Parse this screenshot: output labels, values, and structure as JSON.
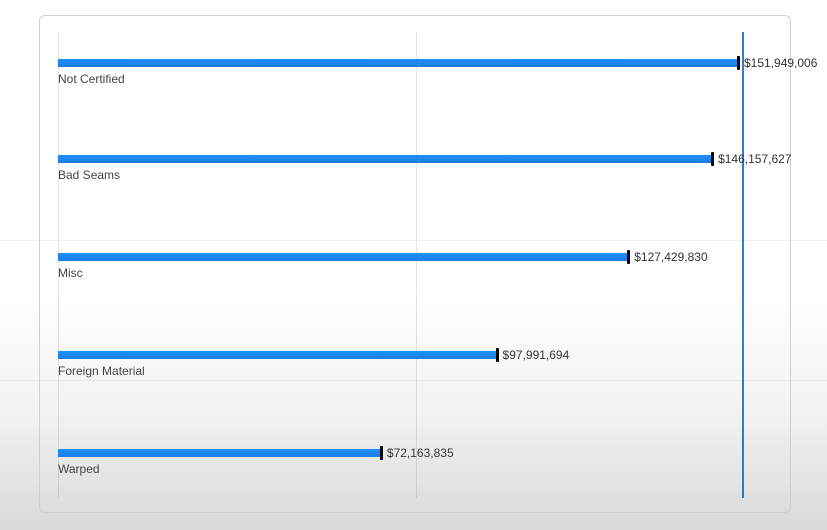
{
  "chart_data": {
    "type": "bar",
    "orientation": "horizontal",
    "categories": [
      "Not Certified",
      "Bad Seams",
      "Misc",
      "Foreign Material",
      "Warped"
    ],
    "values": [
      151949006,
      146157627,
      127429830,
      97991694,
      72163835
    ],
    "value_labels": [
      "$151,949,006",
      "$146,157,627",
      "$127,429,830",
      "$97,991,694",
      "$72,163,835"
    ],
    "bar_color": "#1e90ff",
    "reference_line": 147000000,
    "x_axis": {
      "min": 0,
      "max": 160000000,
      "gridline_step_approx": 80000000
    },
    "title": "",
    "xlabel": "",
    "ylabel": ""
  },
  "rows": [
    {
      "category": "Not Certified",
      "value_label": "$151,949,006",
      "pct": 0.9497
    },
    {
      "category": "Bad Seams",
      "value_label": "$146,157,627",
      "pct": 0.9135
    },
    {
      "category": "Misc",
      "value_label": "$127,429,830",
      "pct": 0.7964
    },
    {
      "category": "Foreign Material",
      "value_label": "$97,991,694",
      "pct": 0.6125
    },
    {
      "category": "Warped",
      "value_label": "$72,163,835",
      "pct": 0.451
    }
  ],
  "layout": {
    "row_tops": [
      16,
      112,
      210,
      308,
      406
    ],
    "grid_v": [
      0.0,
      0.5
    ],
    "ref_v": 0.955,
    "bg_h_lines": [
      240,
      380
    ]
  }
}
